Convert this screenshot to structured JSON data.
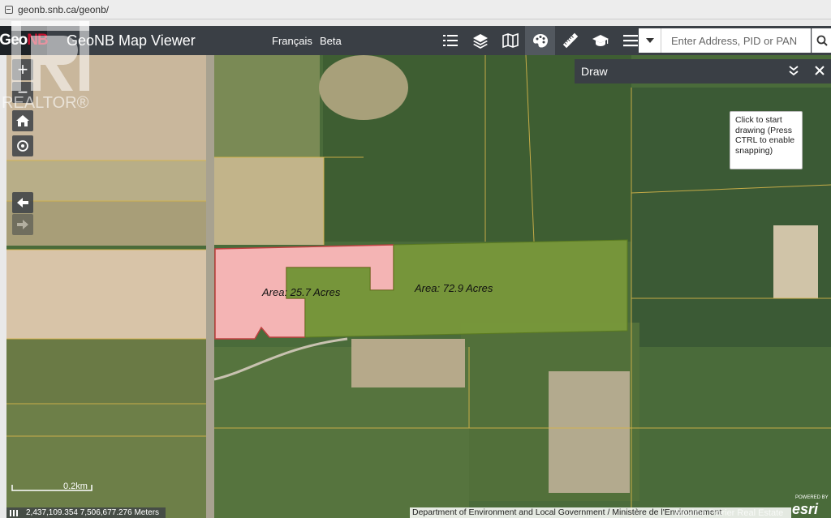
{
  "browser": {
    "url": "geonb.snb.ca/geonb/"
  },
  "header": {
    "logo_text_geo": "Geo",
    "logo_text_nb": "NB",
    "title": "GeoNB Map Viewer",
    "language_link": "Français",
    "beta_link": "Beta",
    "tools": [
      "list-icon",
      "layers-icon",
      "basemap-icon",
      "draw-palette-icon",
      "measure-ruler-icon",
      "education-icon",
      "menu-icon"
    ],
    "active_tool": "draw-palette-icon"
  },
  "search": {
    "placeholder": "Enter Address, PID or PAN"
  },
  "draw_panel": {
    "title": "Draw",
    "tooltip": "Click to start drawing (Press CTRL to enable snapping)"
  },
  "map": {
    "areas": [
      {
        "label": "Area: 25.7 Acres",
        "color": "#f4b4b4"
      },
      {
        "label": "Area: 72.9 Acres",
        "color": "#7a9a3c"
      }
    ],
    "scale_label": "0.2km",
    "coordinates": "2,437,109.354 7,506,677.276 Meters",
    "attribution": "Department of Environment and Local Government / Ministère de l'Environnement",
    "esri_powered": "POWERED BY",
    "esri_brand": "esri"
  },
  "watermark": {
    "brand": "REALTOR®",
    "footer": "Maxime Poirier Real Estate"
  },
  "colors": {
    "header_bg": "#3a3f45",
    "parcel_line": "#d4b44a",
    "pink_area": "#f4b4b4",
    "green_area": "#7a9a3c"
  }
}
